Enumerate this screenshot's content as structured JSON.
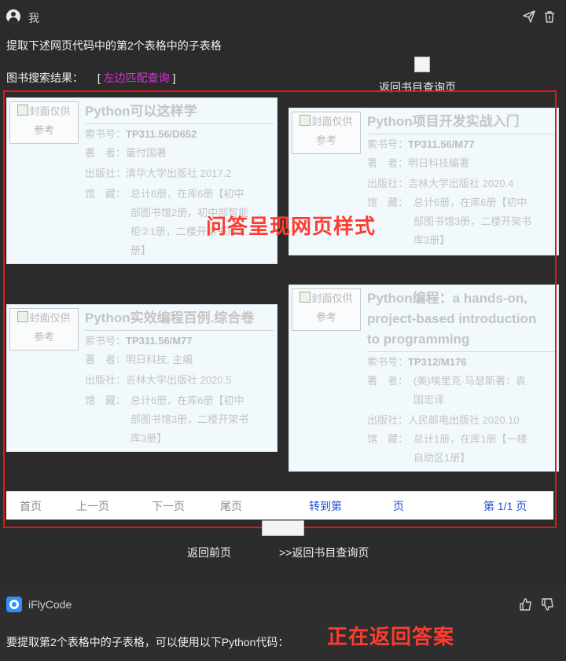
{
  "user": {
    "name": "我"
  },
  "question": "提取下述网页代码中的第2个表格中的子表格",
  "page": {
    "search_label": "图书搜索结果：",
    "bracket_open": "[",
    "match_link": "左边匹配查询",
    "bracket_close": "]",
    "back_catalog_top": "返回书目查询页",
    "books": [
      {
        "cover": [
          "封面仅供",
          "参考"
        ],
        "title": "Python可以这样学",
        "call_label": "索书号：",
        "call_no": "TP311.56/D652",
        "author_label": "著　者：",
        "author": "董付国著",
        "publisher_label": "出版社：",
        "publisher": "清华大学出版社 2017.2",
        "holding_label": "馆　藏：",
        "holding_lines": [
          "总计6册，在库6册【初中",
          "部图书馆2册，初中部智能",
          "柜②1册，二楼开架书库3",
          "册】"
        ]
      },
      {
        "cover": [
          "封面仅供",
          "参考"
        ],
        "title": "Python项目开发实战入门",
        "call_label": "索书号：",
        "call_no": "TP311.56/M77",
        "author_label": "著　者：",
        "author": "明日科技编著",
        "publisher_label": "出版社：",
        "publisher": "吉林大学出版社 2020.4",
        "holding_label": "馆　藏：",
        "holding_lines": [
          "总计6册，在库6册【初中",
          "部图书馆3册，二楼开架书",
          "库3册】"
        ]
      },
      {
        "cover": [
          "封面仅供",
          "参考"
        ],
        "title": "Python实效编程百例.综合卷",
        "call_label": "索书号：",
        "call_no": "TP311.56/M77",
        "author_label": "著　者：",
        "author": "明日科技, 主编",
        "publisher_label": "出版社：",
        "publisher": "吉林大学出版社 2020.5",
        "holding_label": "馆　藏：",
        "holding_lines": [
          "总计6册，在库6册【初中",
          "部图书馆3册，二楼开架书",
          "库3册】"
        ]
      },
      {
        "cover": [
          "封面仅供",
          "参考"
        ],
        "title_lines": [
          "Python编程：a hands-on,",
          "project-based introduction",
          "to programming"
        ],
        "call_label": "索书号：",
        "call_no": "TP312/M176",
        "author_label": "著　者：",
        "author_lines": [
          "(美)埃里克·马瑟斯著：袁",
          "国忠译"
        ],
        "publisher_label": "出版社：",
        "publisher": "人民邮电出版社 2020.10",
        "holding_label": "馆　藏：",
        "holding_lines": [
          "总计1册，在库1册【一楼",
          "自助区1册】"
        ]
      }
    ],
    "pager": {
      "first": "首页",
      "prev": "上一页",
      "next": "下一页",
      "last": "尾页",
      "goto": "转到第",
      "page_unit": "页",
      "page_info": "第 1/1 页"
    },
    "bottom_links": {
      "back_prev": "返回前页",
      "back_catalog": ">>返回书目查询页"
    }
  },
  "annotations": {
    "style_note": "问答呈现网页样式",
    "returning": "正在返回答案"
  },
  "answer": {
    "assistant_name": "iFlyCode",
    "text": "要提取第2个表格中的子表格，可以使用以下Python代码："
  },
  "colors": {
    "frame": "#e01919",
    "link": "#d633d6",
    "pager_blue": "#1f4fd0",
    "card_bg": "#f1f9fd"
  }
}
